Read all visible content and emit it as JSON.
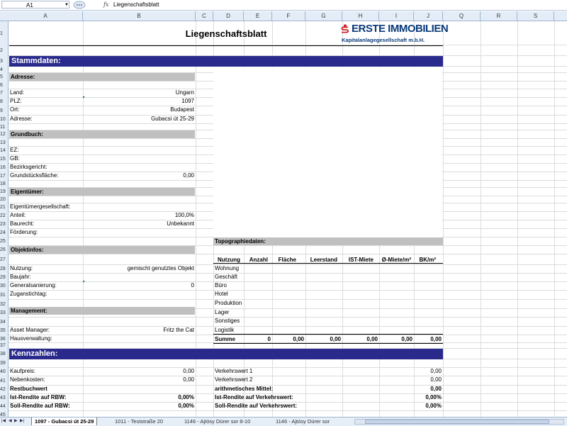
{
  "formula_bar": {
    "name_box": "A1",
    "fx": "fx",
    "content": "Liegenschaftsblatt"
  },
  "columns": [
    "A",
    "B",
    "C",
    "D",
    "E",
    "F",
    "G",
    "H",
    "I",
    "J",
    "Q",
    "R",
    "S"
  ],
  "rows": [
    "1",
    "2",
    "3",
    "4",
    "5",
    "6",
    "7",
    "8",
    "9",
    "10",
    "11",
    "12",
    "13",
    "14",
    "15",
    "16",
    "17",
    "18",
    "19",
    "20",
    "21",
    "22",
    "23",
    "24",
    "25",
    "26",
    "27",
    "28",
    "29",
    "30",
    "31",
    "32",
    "33",
    "34",
    "35",
    "36",
    "37",
    "38",
    "39",
    "40",
    "41",
    "42",
    "43",
    "44",
    "45"
  ],
  "title": "Liegenschaftsblatt",
  "logo": {
    "main": "ERSTE IMMOBILIEN",
    "sub": "Kapitalanlagegesellschaft m.b.H.",
    "color": "#0b3a7a",
    "accent": "#d2232a"
  },
  "sections": {
    "stammdaten": "Stammdaten:",
    "adresse": "Adresse:",
    "grundbuch": "Grundbuch:",
    "eigentuemer": "Eigentümer:",
    "objektinfos": "Objektinfos:",
    "management": "Management:",
    "kennzahlen": "Kennzahlen:",
    "topographie": "Topographiedaten:"
  },
  "adresse": {
    "land_label": "Land:",
    "land": "Ungarn",
    "plz_label": "PLZ:",
    "plz": "1097",
    "ort_label": "Ort:",
    "ort": "Budapest",
    "adresse_label": "Adresse:",
    "adresse": "Gubacsi út 25-29"
  },
  "grundbuch": {
    "ez_label": "EZ:",
    "gb_label": "GB:",
    "bezirk_label": "Bezirksgericht:",
    "flaeche_label": "Grundstücksfläche:",
    "flaeche": "0,00"
  },
  "eigentuemer": {
    "ges_label": "Eigentümergesellschaft:",
    "anteil_label": "Anteil:",
    "anteil": "100,0%",
    "baurecht_label": "Baurecht:",
    "baurecht": "Unbekannt",
    "foerderung_label": "Förderung:"
  },
  "objekt": {
    "nutzung_label": "Nutzung:",
    "nutzung": "gemischt genutztes Objekt",
    "baujahr_label": "Baujahr:",
    "general_label": "Generalsanierung:",
    "general": "0",
    "zugang_label": "Zuganstichtag:"
  },
  "management": {
    "am_label": "Asset Manager:",
    "am": "Fritz the Cat",
    "hv_label": "Hausverwaltung:"
  },
  "topo": {
    "headers": [
      "Nutzung",
      "Anzahl",
      "Fläche",
      "Leerstand",
      "IST-Miete",
      "Ø-Miete/m²",
      "BK/m²"
    ],
    "rows": [
      "Wohnung",
      "Geschäft",
      "Büro",
      "Hotel",
      "Produktion",
      "Lager",
      "Sonstiges",
      "Logistik"
    ],
    "summe_label": "Summe",
    "summe": [
      "0",
      "0,00",
      "0,00",
      "0,00",
      "0,00",
      "0,00"
    ]
  },
  "kennzahlen": {
    "kaufpreis_label": "Kaufpreis:",
    "kaufpreis": "0,00",
    "neben_label": "Nebenkosten:",
    "neben": "0,00",
    "rest_label": "Restbuchwert",
    "ist_rbw_label": "Ist-Rendite auf RBW:",
    "ist_rbw": "0,00%",
    "soll_rbw_label": "Soll-Rendite auf RBW:",
    "soll_rbw": "0,00%",
    "vw1_label": "Verkehrswert 1",
    "vw1": "0,00",
    "vw2_label": "Verkehrswert 2",
    "vw2": "0,00",
    "mittel_label": "arithmetisches Mittel:",
    "mittel": "0,00",
    "ist_vw_label": "Ist-Rendite auf Verkehrswert:",
    "ist_vw": "0,00%",
    "soll_vw_label": "Soll-Rendite auf Verkehrswert:",
    "soll_vw": "0,00%"
  },
  "tabs": [
    "1097 - Gubacsi út 25-29",
    "1011 - Teststraße 20",
    "1146 - Ajtósy Dürer sor 8-10",
    "1146 - Ajtósy Dürer sor"
  ],
  "colors": {
    "band": "#2a2a8c",
    "section_gray": "#c0c0c0",
    "header_bg": "#e4ecf7"
  }
}
